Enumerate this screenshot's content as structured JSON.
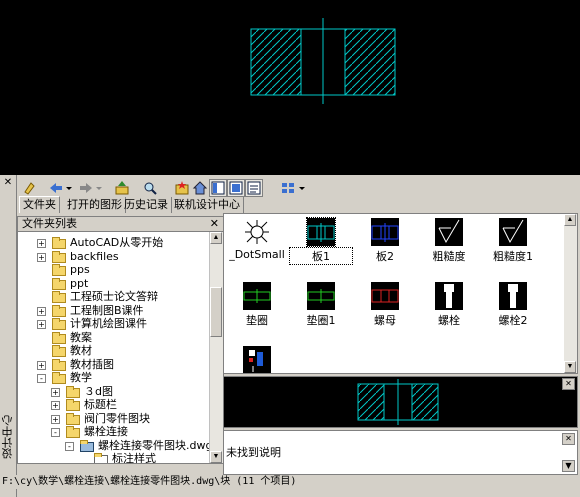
{
  "palette": {
    "cad_cyan": "#00c8c8",
    "folder_yellow": "#f5d66b",
    "panel_gray": "#d4d0c8"
  },
  "window": {
    "vertical_title": "设计中心"
  },
  "toolbar": {
    "icons": [
      "load-icon",
      "back-icon",
      "forward-icon",
      "up-icon",
      "search-icon",
      "favorites-icon",
      "home-icon",
      "tree-toggle-icon",
      "preview-icon",
      "description-icon",
      "views-icon"
    ]
  },
  "tabs": [
    {
      "label": "文件夹"
    },
    {
      "label": "打开的图形"
    },
    {
      "label": "历史记录"
    },
    {
      "label": "联机设计中心"
    }
  ],
  "tree": {
    "header": "文件夹列表",
    "items": [
      {
        "label": "AutoCAD从零开始",
        "level": 1,
        "expander": "+"
      },
      {
        "label": "backfiles",
        "level": 1,
        "expander": "+"
      },
      {
        "label": "pps",
        "level": 1,
        "expander": ""
      },
      {
        "label": "ppt",
        "level": 1,
        "expander": ""
      },
      {
        "label": "工程硕士论文答辩",
        "level": 1,
        "expander": ""
      },
      {
        "label": "工程制图B课件",
        "level": 1,
        "expander": "+"
      },
      {
        "label": "计算机绘图课件",
        "level": 1,
        "expander": "+"
      },
      {
        "label": "教案",
        "level": 1,
        "expander": ""
      },
      {
        "label": "教材",
        "level": 1,
        "expander": ""
      },
      {
        "label": "教材插图",
        "level": 1,
        "expander": "+"
      },
      {
        "label": "教学",
        "level": 1,
        "expander": "-"
      },
      {
        "label": "３d图",
        "level": 2,
        "expander": "+"
      },
      {
        "label": "标题栏",
        "level": 2,
        "expander": "+"
      },
      {
        "label": "阀门零件图块",
        "level": 2,
        "expander": "+"
      },
      {
        "label": "螺栓连接",
        "level": 2,
        "expander": "-"
      },
      {
        "label": "螺栓连接零件图块.dwg",
        "level": 3,
        "expander": "-"
      },
      {
        "label": "标注样式",
        "level": 4,
        "expander": ""
      }
    ]
  },
  "blocks": [
    {
      "name": "_DotSmall",
      "icon": "dot-pattern-icon"
    },
    {
      "name": "板1",
      "icon": "plate-icon",
      "selected": true
    },
    {
      "name": "板2",
      "icon": "plate-icon"
    },
    {
      "name": "粗糙度",
      "icon": "roughness-icon"
    },
    {
      "name": "粗糙度1",
      "icon": "roughness-icon"
    },
    {
      "name": "垫圈",
      "icon": "washer-icon"
    },
    {
      "name": "垫圈1",
      "icon": "washer-icon"
    },
    {
      "name": "螺母",
      "icon": "nut-icon"
    },
    {
      "name": "螺栓",
      "icon": "bolt-icon"
    },
    {
      "name": "螺栓2",
      "icon": "bolt-icon"
    },
    {
      "name": "",
      "icon": "misc-icon"
    }
  ],
  "description": {
    "text": "未找到说明"
  },
  "status": {
    "text": "F:\\cy\\数学\\螺栓连接\\螺栓连接零件图块.dwg\\块 (11 个项目)"
  }
}
